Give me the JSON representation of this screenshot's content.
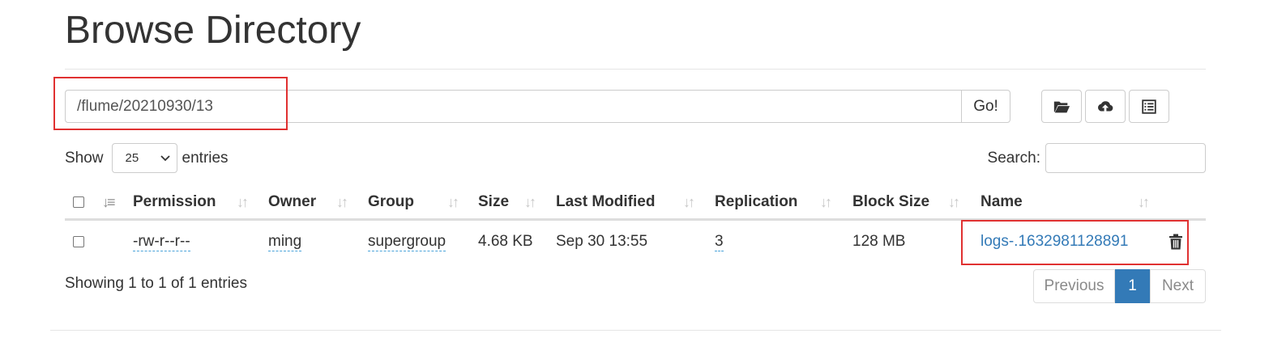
{
  "page": {
    "title": "Browse Directory"
  },
  "path_bar": {
    "value": "/flume/20210930/13",
    "go_label": "Go!"
  },
  "toolbar": {
    "icons": [
      "folder-open-icon",
      "cloud-upload-icon",
      "list-icon"
    ]
  },
  "table_controls": {
    "show_label": "Show",
    "page_length": "25",
    "entries_label": "entries",
    "search_label": "Search:",
    "search_value": ""
  },
  "table": {
    "columns": [
      "Permission",
      "Owner",
      "Group",
      "Size",
      "Last Modified",
      "Replication",
      "Block Size",
      "Name"
    ],
    "rows": [
      {
        "permission": "-rw-r--r--",
        "owner": "ming",
        "group": "supergroup",
        "size": "4.68 KB",
        "last_modified": "Sep 30 13:55",
        "replication": "3",
        "block_size": "128 MB",
        "name": "logs-.1632981128891"
      }
    ]
  },
  "footer": {
    "info": "Showing 1 to 1 of 1 entries",
    "pagination": {
      "previous": "Previous",
      "current": "1",
      "next": "Next"
    }
  },
  "colors": {
    "link": "#337ab7",
    "highlight": "#e03131",
    "active_page": "#337ab7"
  }
}
